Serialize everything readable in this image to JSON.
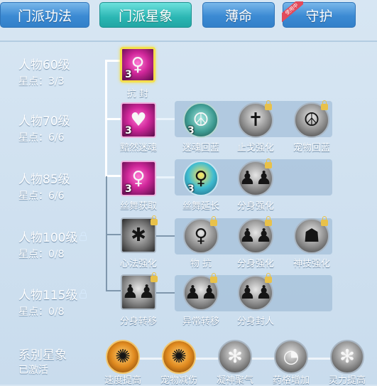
{
  "tabs": [
    {
      "label": "门派功法",
      "state": "normal"
    },
    {
      "label": "门派星象",
      "state": "active"
    },
    {
      "label": "薄命",
      "state": "normal"
    },
    {
      "label": "守护",
      "state": "normal",
      "badge": "使用中"
    }
  ],
  "levels": [
    {
      "label": "人物60级",
      "points": "星点：3/3",
      "locked": false
    },
    {
      "label": "人物70级",
      "points": "星点：6/6",
      "locked": false
    },
    {
      "label": "人物85级",
      "points": "星点：6/6",
      "locked": false
    },
    {
      "label": "人物100级",
      "points": "星点：0/8",
      "locked": true
    },
    {
      "label": "人物115级",
      "points": "星点：0/8",
      "locked": true
    }
  ],
  "series": {
    "label": "系别星象",
    "status": "已激活"
  },
  "skills": {
    "r1": [
      {
        "name": "抗 封",
        "count": "3",
        "icon": "dancer-icon",
        "style": "pink",
        "selected": true,
        "locked": false
      }
    ],
    "r2": [
      {
        "name": "黯然迷魂",
        "count": "3",
        "icon": "heart-icon",
        "style": "pink",
        "locked": false
      },
      {
        "name": "迷魂回蓝",
        "count": "3",
        "icon": "swirl-icon",
        "style": "teal",
        "locked": false
      },
      {
        "name": "止戈强化",
        "count": "",
        "icon": "halberd-icon",
        "style": "gray",
        "locked": true
      },
      {
        "name": "宠物回蓝",
        "count": "",
        "icon": "swirl-icon",
        "style": "gray",
        "locked": true
      }
    ],
    "r3": [
      {
        "name": "丝舞获取",
        "count": "3",
        "icon": "dancer-icon",
        "style": "pink",
        "locked": false
      },
      {
        "name": "丝舞延长",
        "count": "3",
        "icon": "dancer-icon",
        "style": "color",
        "locked": false
      },
      {
        "name": "分身强化",
        "count": "",
        "icon": "twin-figure-icon",
        "style": "gray",
        "locked": true
      }
    ],
    "r4": [
      {
        "name": "心法强化",
        "count": "",
        "icon": "spider-icon",
        "style": "spider",
        "locked": true
      },
      {
        "name": "物 抗",
        "count": "",
        "icon": "dancer-icon",
        "style": "gray",
        "locked": true
      },
      {
        "name": "分身强化",
        "count": "",
        "icon": "twin-figure-icon",
        "style": "gray",
        "locked": true
      },
      {
        "name": "神技强化",
        "count": "",
        "icon": "mask-icon",
        "style": "gray",
        "locked": true
      }
    ],
    "r5": [
      {
        "name": "分身转移",
        "count": "",
        "icon": "twin-figure-icon",
        "style": "gray",
        "locked": true
      },
      {
        "name": "异常转移",
        "count": "",
        "icon": "twin-figure-icon",
        "style": "gray",
        "locked": true
      },
      {
        "name": "分身封人",
        "count": "",
        "icon": "twin-figure-icon",
        "style": "gray",
        "locked": true
      }
    ],
    "bottom": [
      {
        "name": "速度提高",
        "icon": "fire-icon",
        "style": "gold"
      },
      {
        "name": "宠物减伤",
        "icon": "fire-icon",
        "style": "gold"
      },
      {
        "name": "凝神聚气",
        "icon": "snowflake-icon",
        "style": "gray"
      },
      {
        "name": "药格增加",
        "icon": "drop-icon",
        "style": "gray"
      },
      {
        "name": "灵力提高",
        "icon": "snowflake-icon",
        "style": "gray"
      }
    ]
  }
}
